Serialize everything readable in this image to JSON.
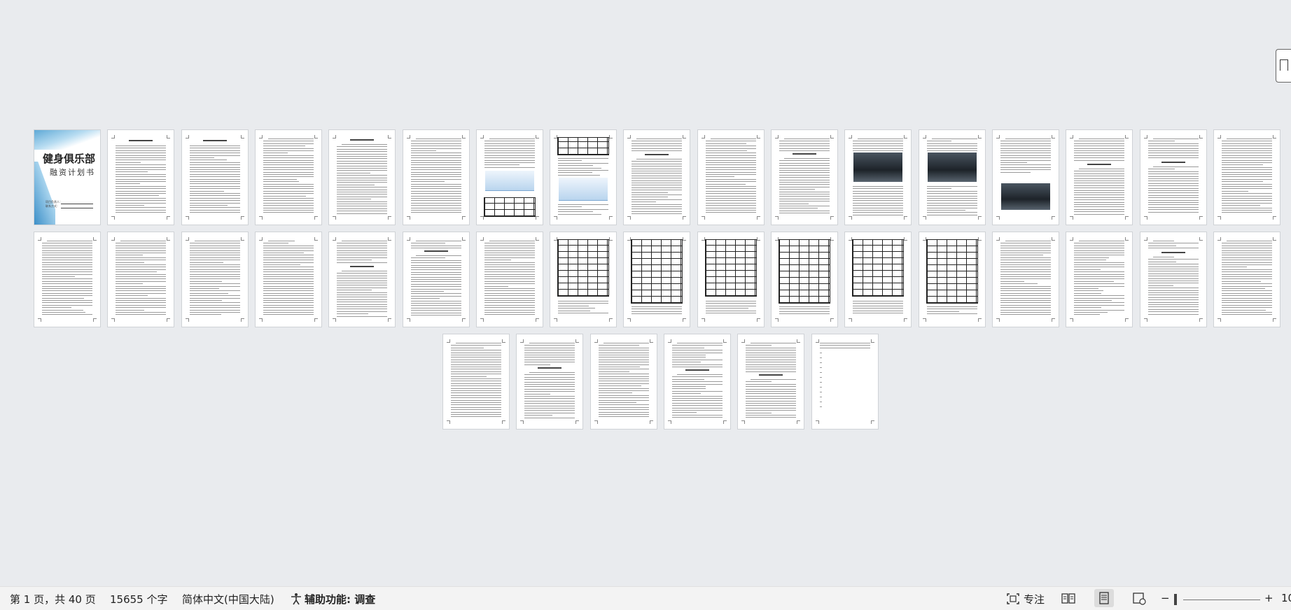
{
  "document": {
    "cover_title": "健身俱乐部",
    "cover_subtitle": "融资计划书",
    "cover_lines": [
      "项目负责人：",
      "联系方式："
    ]
  },
  "statusbar": {
    "page_info": "第 1 页，共 40 页",
    "word_count": "15655 个字",
    "language": "简体中文(中国大陆)",
    "accessibility": "辅助功能: 调查",
    "focus": "专注",
    "zoom_minus": "−",
    "zoom_plus": "+",
    "zoom_value": "10"
  },
  "icons": {
    "accessibility": "accessibility-icon",
    "focus": "focus-icon",
    "read_mode": "read-mode-icon",
    "print_layout": "print-layout-icon",
    "web_layout": "web-layout-icon",
    "bookmark": "bookmark-icon"
  }
}
